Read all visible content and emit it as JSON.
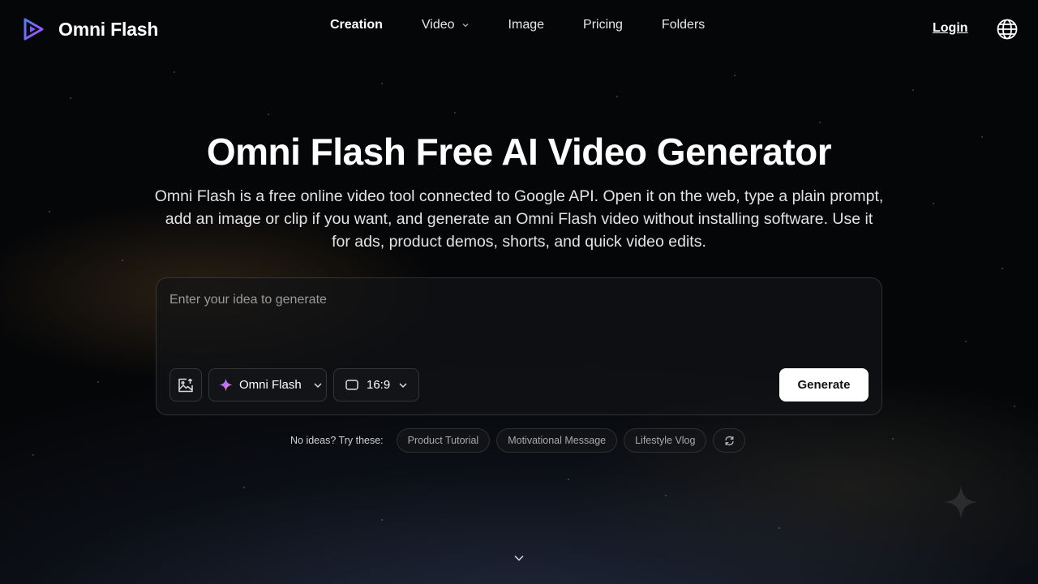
{
  "brand": {
    "name": "Omni Flash",
    "logo_icon": "play-triangle-logo-icon"
  },
  "nav": {
    "items": [
      {
        "label": "Creation",
        "active": true
      },
      {
        "label": "Video",
        "has_dropdown": true
      },
      {
        "label": "Image"
      },
      {
        "label": "Pricing"
      },
      {
        "label": "Folders"
      }
    ],
    "login_label": "Login",
    "language_icon": "globe-icon"
  },
  "hero": {
    "title": "Omni Flash Free AI Video Generator",
    "subtitle": "Omni Flash is a free online video tool connected to Google API. Open it on the web, type a plain prompt, add an image or clip if you want, and generate an Omni Flash video without installing software. Use it for ads, product demos, shorts, and quick video edits."
  },
  "prompt": {
    "placeholder": "Enter your idea to generate",
    "value": "",
    "model_label": "Omni Flash",
    "ratio_label": "16:9",
    "generate_label": "Generate"
  },
  "ideas": {
    "label": "No ideas? Try these:",
    "chips": [
      "Product Tutorial",
      "Motivational Message",
      "Lifestyle Vlog"
    ]
  },
  "colors": {
    "background": "#050608",
    "accent_button": "#ffffff",
    "logo_gradient_start": "#4f7cff",
    "logo_gradient_end": "#b04cff"
  }
}
